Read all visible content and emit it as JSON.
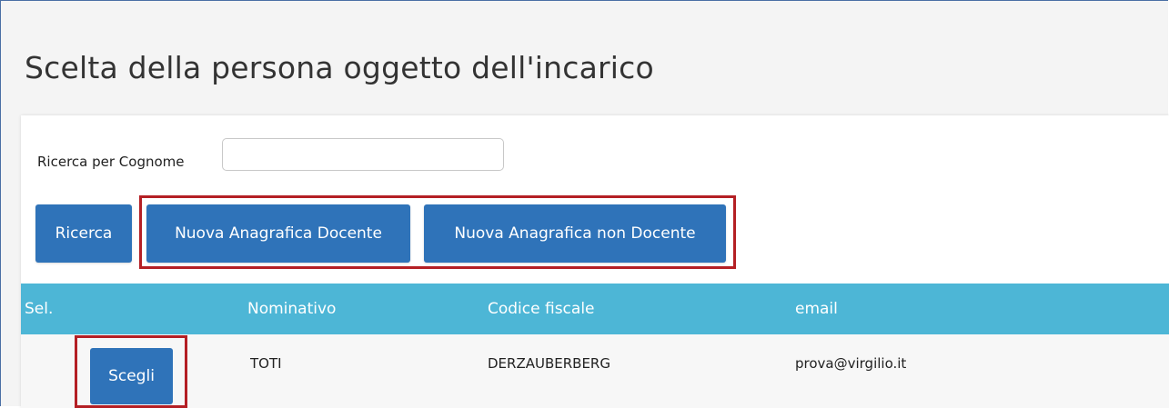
{
  "page": {
    "title": "Scelta della persona oggetto dell'incarico"
  },
  "search": {
    "label": "Ricerca per Cognome",
    "value": "",
    "placeholder": ""
  },
  "buttons": {
    "search_label": "Ricerca",
    "new_docente_label": "Nuova Anagrafica Docente",
    "new_non_docente_label": "Nuova Anagrafica non Docente"
  },
  "table": {
    "columns": [
      "Sel.",
      "Nominativo",
      "Codice fiscale",
      "email"
    ],
    "rows": [
      {
        "action_label": "Scegli",
        "nominativo": "TOTI",
        "codice_fiscale": "DERZAUBERBERG",
        "email": "prova@virgilio.it"
      }
    ]
  },
  "colors": {
    "primary_button": "#2f73b9",
    "table_header": "#4db6d6",
    "highlight": "#b41f24"
  }
}
